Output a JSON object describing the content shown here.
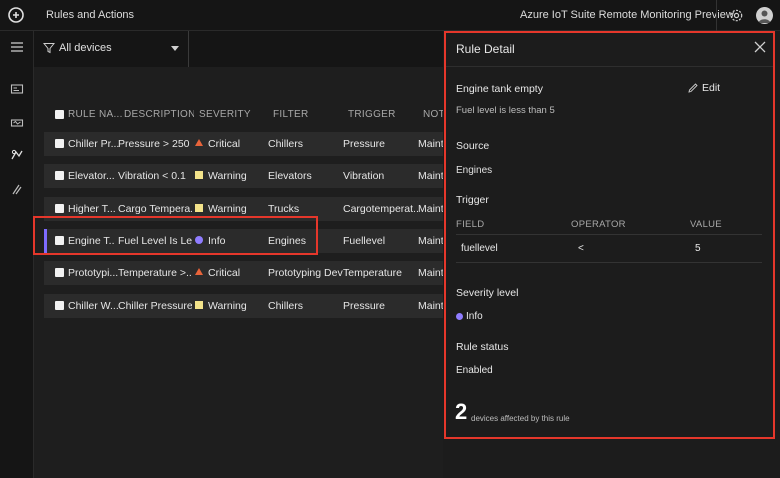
{
  "header": {
    "page_title": "Rules and Actions",
    "app_title": "Azure IoT Suite Remote Monitoring Preview",
    "settings_icon": "gear-icon",
    "avatar_icon": "user-avatar-icon"
  },
  "nav": {
    "icons": [
      "hamburger-menu-icon",
      "dashboard-icon",
      "devices-icon",
      "rules-icon",
      "maintenance-icon"
    ]
  },
  "filter": {
    "selected": "All devices"
  },
  "grid": {
    "columns": [
      "RULE NA...",
      "DESCRIPTION",
      "SEVERITY",
      "FILTER",
      "TRIGGER",
      "NOT"
    ],
    "rows": [
      {
        "name": "Chiller Pr...",
        "description": "Pressure > 250",
        "severity": "Critical",
        "severity_icon": "critical",
        "filter": "Chillers",
        "trigger": "Pressure",
        "notification": "Maint"
      },
      {
        "name": "Elevator...",
        "description": "Vibration < 0.1",
        "severity": "Warning",
        "severity_icon": "warning",
        "filter": "Elevators",
        "trigger": "Vibration",
        "notification": "Maint"
      },
      {
        "name": "Higher T...",
        "description": "Cargo Tempera...",
        "severity": "Warning",
        "severity_icon": "warning",
        "filter": "Trucks",
        "trigger": "Cargotemperat...",
        "notification": "Maint"
      },
      {
        "name": "Engine T...",
        "description": "Fuel Level Is Le...",
        "severity": "Info",
        "severity_icon": "info",
        "filter": "Engines",
        "trigger": "Fuellevel",
        "notification": "Maint",
        "selected": true
      },
      {
        "name": "Prototypi...",
        "description": "Temperature >...",
        "severity": "Critical",
        "severity_icon": "critical",
        "filter": "Prototyping Devic",
        "trigger": "Temperature",
        "notification": "Maint"
      },
      {
        "name": "Chiller W...",
        "description": "Chiller Pressure...",
        "severity": "Warning",
        "severity_icon": "warning",
        "filter": "Chillers",
        "trigger": "Pressure",
        "notification": "Maint"
      }
    ]
  },
  "colors": {
    "critical": "#e8643a",
    "warning": "#f3e38a",
    "info": "#8f7cff",
    "highlight": "#e5372b"
  },
  "detail": {
    "title": "Rule Detail",
    "rule_name": "Engine tank empty",
    "rule_description": "Fuel level is less than 5",
    "edit_label": "Edit",
    "source_label": "Source",
    "source_value": "Engines",
    "trigger_label": "Trigger",
    "condition_headers": {
      "field": "FIELD",
      "operator": "OPERATOR",
      "value": "VALUE"
    },
    "condition": {
      "field": "fuellevel",
      "operator": "<",
      "value": "5"
    },
    "severity_label": "Severity level",
    "severity_value": "Info",
    "status_label": "Rule status",
    "status_value": "Enabled",
    "devices_count": "2",
    "devices_caption": "devices affected by this rule"
  }
}
